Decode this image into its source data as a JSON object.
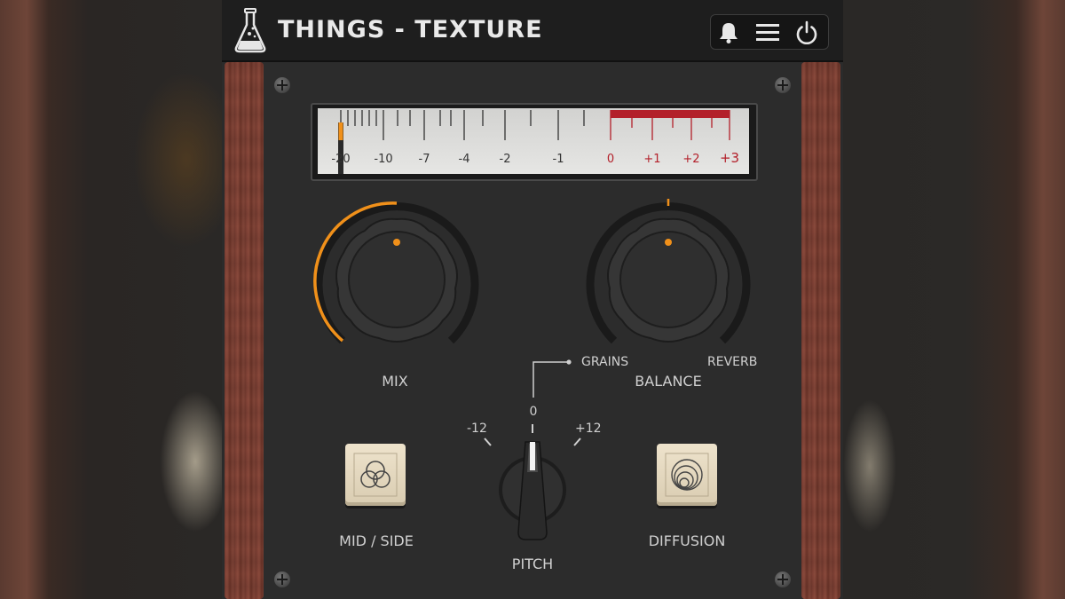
{
  "plugin": {
    "title": "THINGS - TEXTURE",
    "accent_color": "#f0901a",
    "meter_red": "#b3202a"
  },
  "header": {
    "icons": [
      "flask-logo-icon",
      "bell-icon",
      "menu-icon",
      "power-icon"
    ]
  },
  "meter": {
    "scale_labels": [
      "-20",
      "-10",
      "-7",
      "-4",
      "-2",
      "-1",
      "0",
      "+1",
      "+2",
      "+3"
    ]
  },
  "controls": {
    "mix": {
      "label": "MIX",
      "value_fraction": 0.5
    },
    "balance": {
      "label": "BALANCE",
      "left_label": "GRAINS",
      "right_label": "REVERB",
      "value_fraction": 0.5
    },
    "pitch": {
      "label": "PITCH",
      "min_label": "-12",
      "center_label": "0",
      "max_label": "+12"
    },
    "mid_side": {
      "label": "MID / SIDE"
    },
    "diffusion": {
      "label": "DIFFUSION"
    }
  }
}
